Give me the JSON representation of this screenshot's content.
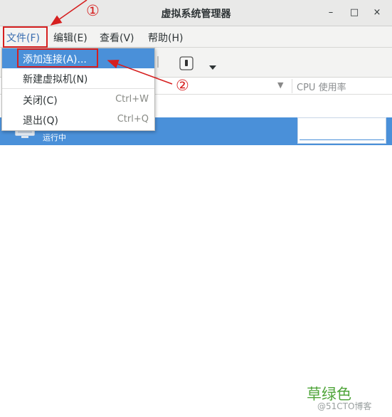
{
  "window": {
    "title": "虚拟系统管理器"
  },
  "window_controls": {
    "minimize": "–",
    "maximize": "□",
    "close": "×"
  },
  "menubar": {
    "items": [
      "文件(F)",
      "编辑(E)",
      "查看(V)",
      "帮助(H)"
    ]
  },
  "file_menu": {
    "items": [
      {
        "label": "添加连接(A)...",
        "accel": ""
      },
      {
        "label": "新建虚拟机(N)",
        "accel": ""
      },
      {
        "label": "关闭(C)",
        "accel": "Ctrl+W"
      },
      {
        "label": "退出(Q)",
        "accel": "Ctrl+Q"
      }
    ]
  },
  "list": {
    "cpu_column": "CPU 使用率"
  },
  "vm_row": {
    "status": "运行中"
  },
  "annotations": {
    "step1": "①",
    "step2": "②"
  },
  "watermark": {
    "text": "草绿色",
    "source": "@51CTO博客"
  },
  "colors": {
    "accent": "#4a90d9",
    "annotation": "#d62020",
    "watermark": "#4fa53a"
  }
}
